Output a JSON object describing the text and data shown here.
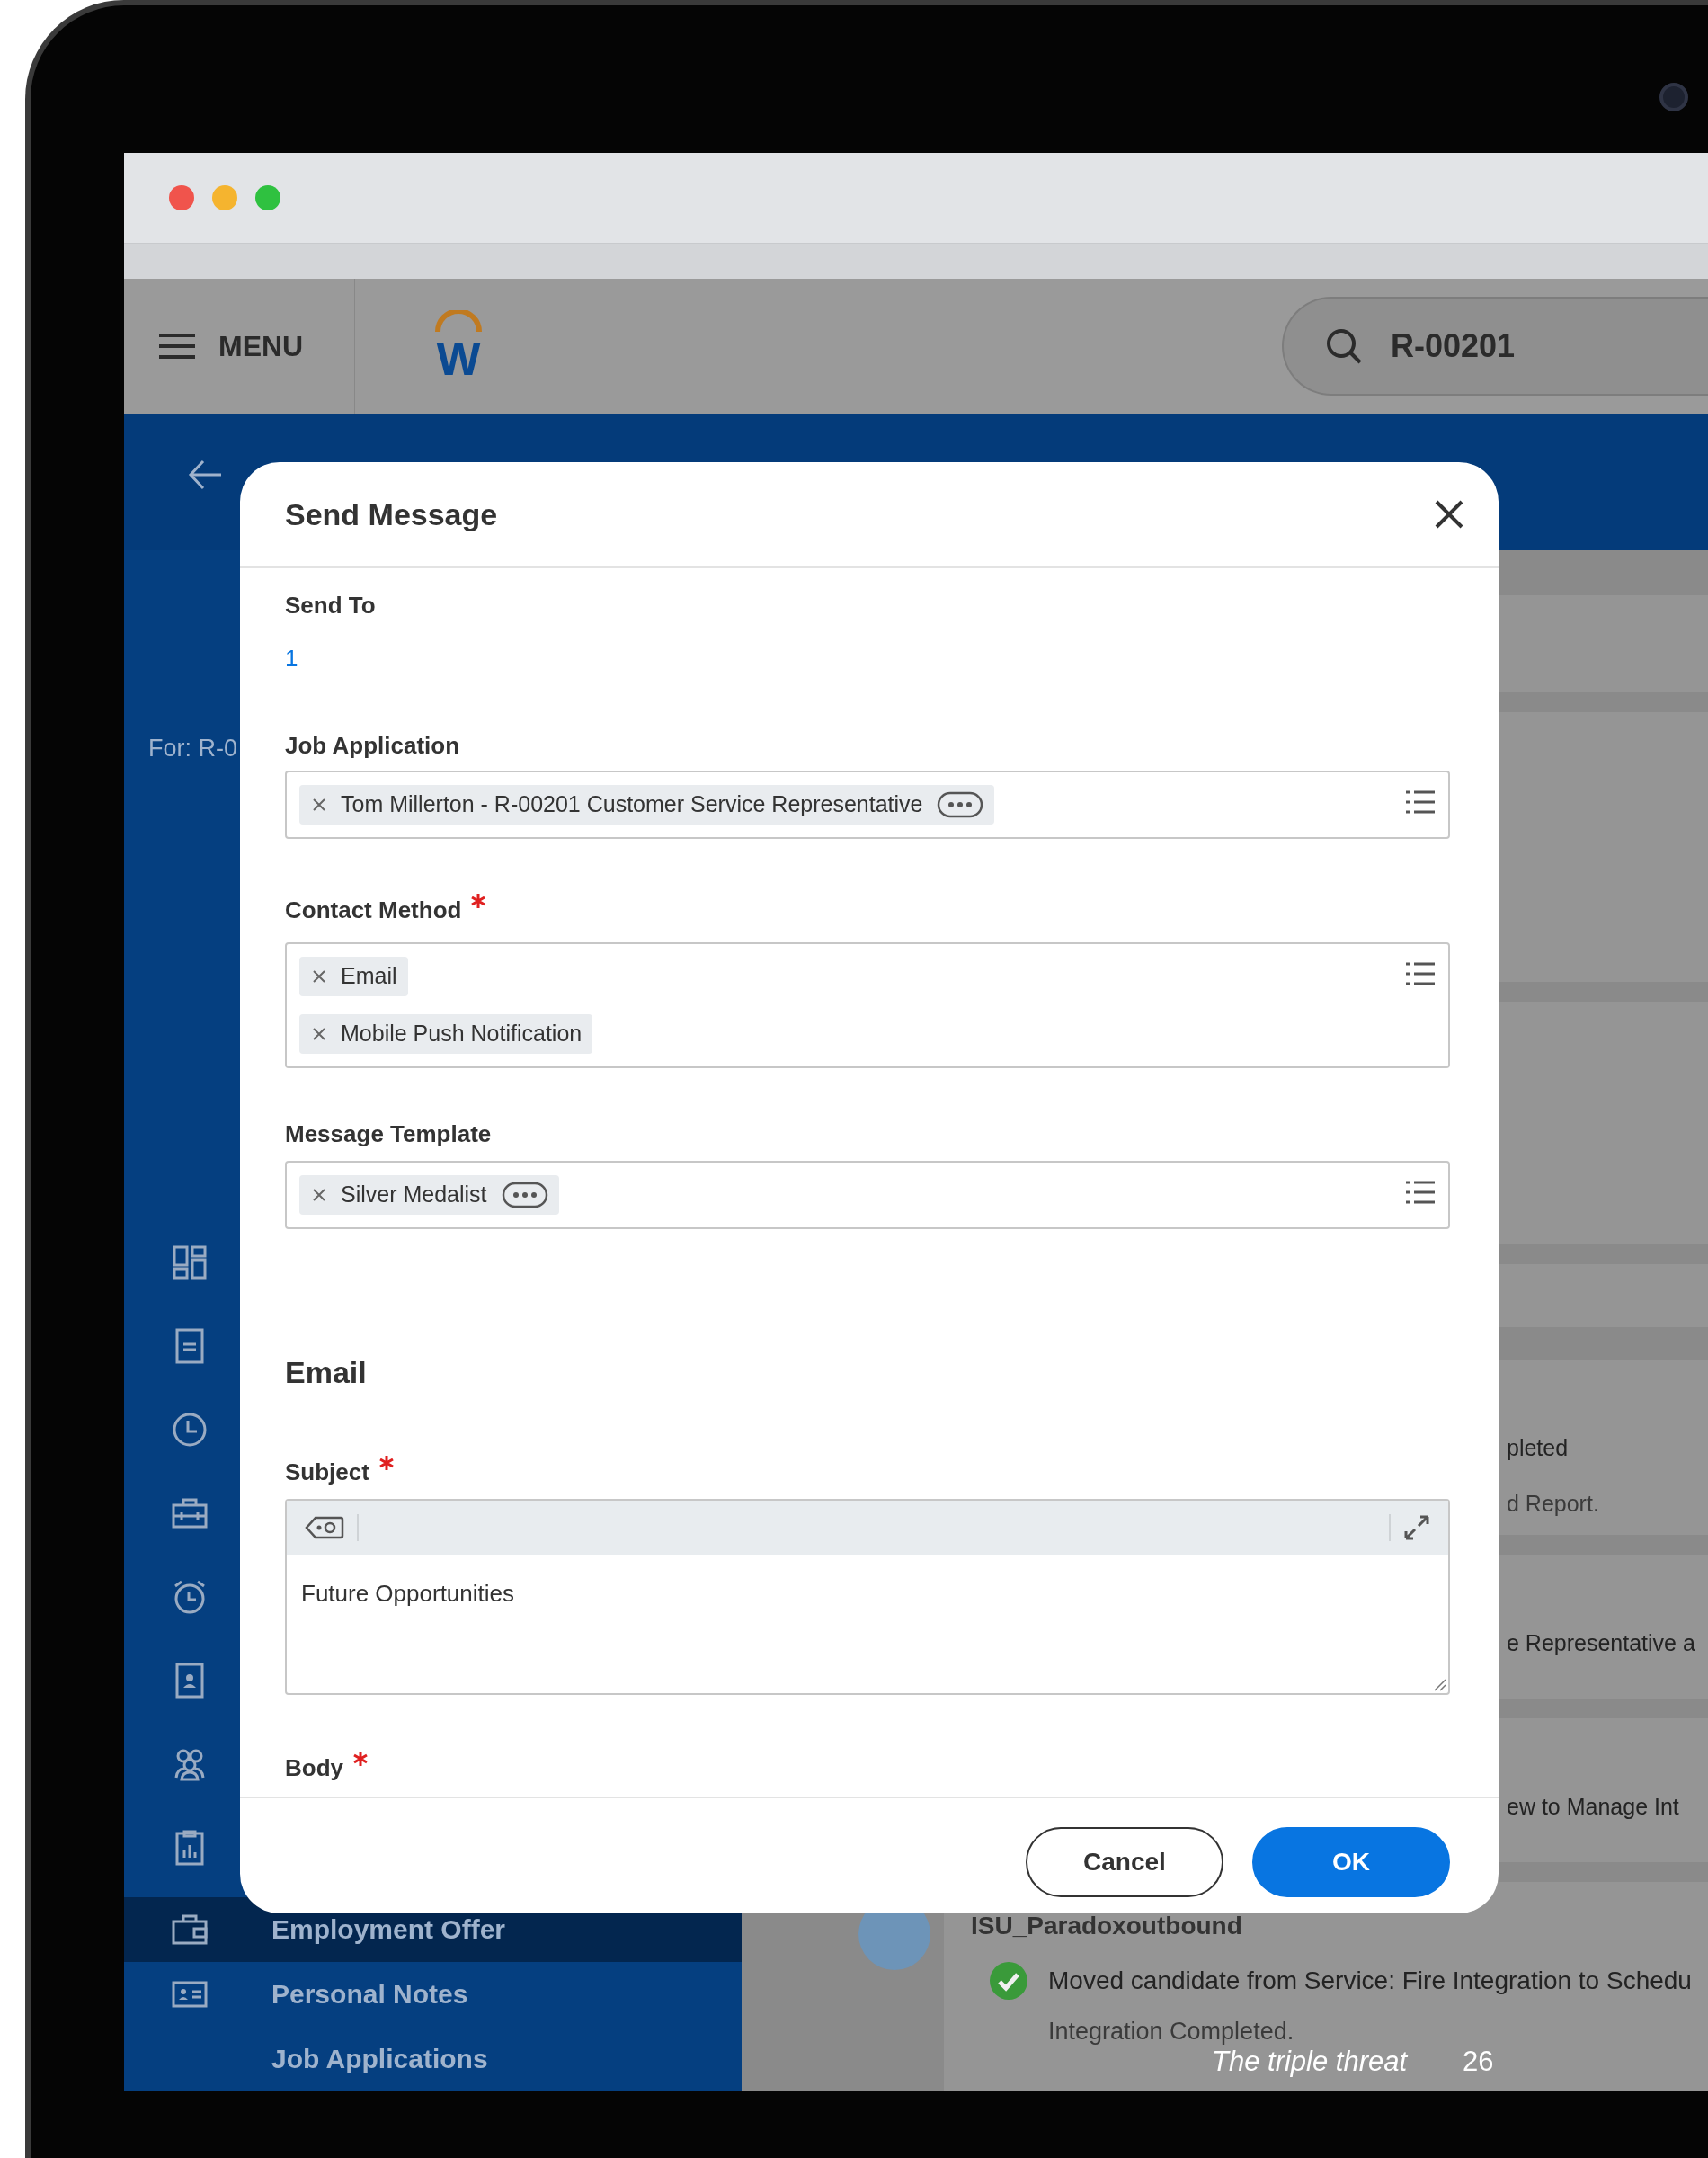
{
  "header": {
    "menu_label": "MENU",
    "logo_letter": "W",
    "search_value": "R-00201"
  },
  "page": {
    "for_label": "For: R-0"
  },
  "sidebar": {
    "items": [
      {
        "label": "Employment Offer",
        "selected": true
      },
      {
        "label": "Personal Notes",
        "selected": false
      },
      {
        "label": "Job Applications",
        "selected": false
      }
    ]
  },
  "background_items": [
    {
      "text": "pleted",
      "detail": "d Report."
    },
    {
      "text": "e Representative a"
    },
    {
      "text": "ew to Manage Int"
    }
  ],
  "activity": {
    "title": "ISU_Paradoxoutbound",
    "message": "Moved candidate from Service: Fire Integration to Schedu",
    "status": "Integration Completed."
  },
  "dialog": {
    "title": "Send Message",
    "send_to": {
      "label": "Send To",
      "value": "1"
    },
    "fields": [
      {
        "label": "Job Application",
        "required": false,
        "tokens": [
          {
            "text": "Tom Millerton - R-00201 Customer Service Representative",
            "more": true
          }
        ]
      },
      {
        "label": "Contact Method",
        "required": true,
        "tokens": [
          {
            "text": "Email",
            "more": false
          },
          {
            "text": "Mobile Push Notification",
            "more": false
          }
        ]
      },
      {
        "label": "Message Template",
        "required": false,
        "tokens": [
          {
            "text": "Silver Medalist",
            "more": true
          }
        ]
      }
    ],
    "section_title": "Email",
    "subject": {
      "label": "Subject",
      "required": true,
      "value": "Future Opportunities"
    },
    "body": {
      "label": "Body",
      "required": true
    },
    "buttons": [
      {
        "label": "Cancel",
        "kind": "secondary"
      },
      {
        "label": "OK",
        "kind": "primary"
      }
    ]
  },
  "footer": {
    "title": "The triple threat",
    "page": "26"
  }
}
